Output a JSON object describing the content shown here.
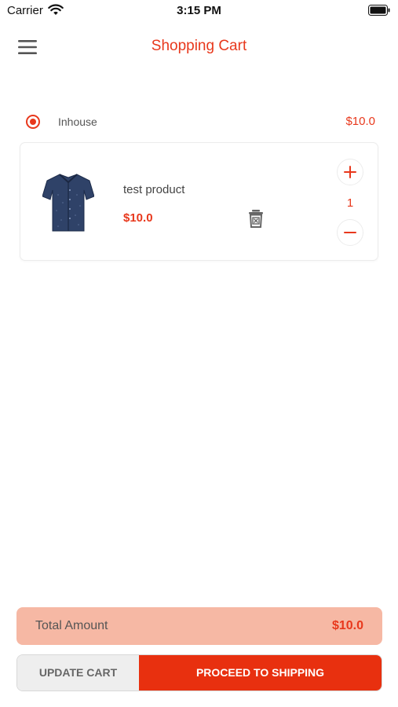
{
  "status_bar": {
    "carrier": "Carrier",
    "time": "3:15 PM"
  },
  "header": {
    "title": "Shopping Cart",
    "menu_icon": "hamburger-menu-icon"
  },
  "seller": {
    "name": "Inhouse",
    "subtotal": "$10.0",
    "selected": true
  },
  "cart_items": [
    {
      "name": "test product",
      "price": "$10.0",
      "quantity": "1",
      "image_icon": "shirt-icon"
    }
  ],
  "summary": {
    "total_label": "Total Amount",
    "total_value": "$10.0"
  },
  "actions": {
    "update_label": "UPDATE CART",
    "proceed_label": "PROCEED TO SHIPPING"
  },
  "colors": {
    "accent": "#e8381c",
    "total_bar": "#f6b8a4",
    "update_button": "#eeeeee"
  }
}
